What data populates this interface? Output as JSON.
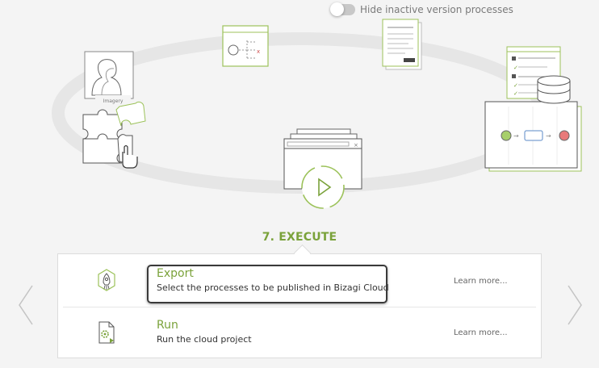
{
  "toggle": {
    "label": "Hide inactive version processes",
    "on": false
  },
  "scene": {
    "imagery_caption": "Imagery"
  },
  "step": {
    "title": "7. EXECUTE"
  },
  "items": [
    {
      "title": "Export",
      "description": "Select the processes to be published in Bizagi Cloud",
      "link": "Learn more...",
      "icon": "rocket-icon"
    },
    {
      "title": "Run",
      "description": "Run the cloud project",
      "link": "Learn more...",
      "icon": "gear-document-icon"
    }
  ],
  "colors": {
    "accent": "#7aa23a",
    "muted": "#7a7a7a",
    "border": "#dcdcdc"
  }
}
